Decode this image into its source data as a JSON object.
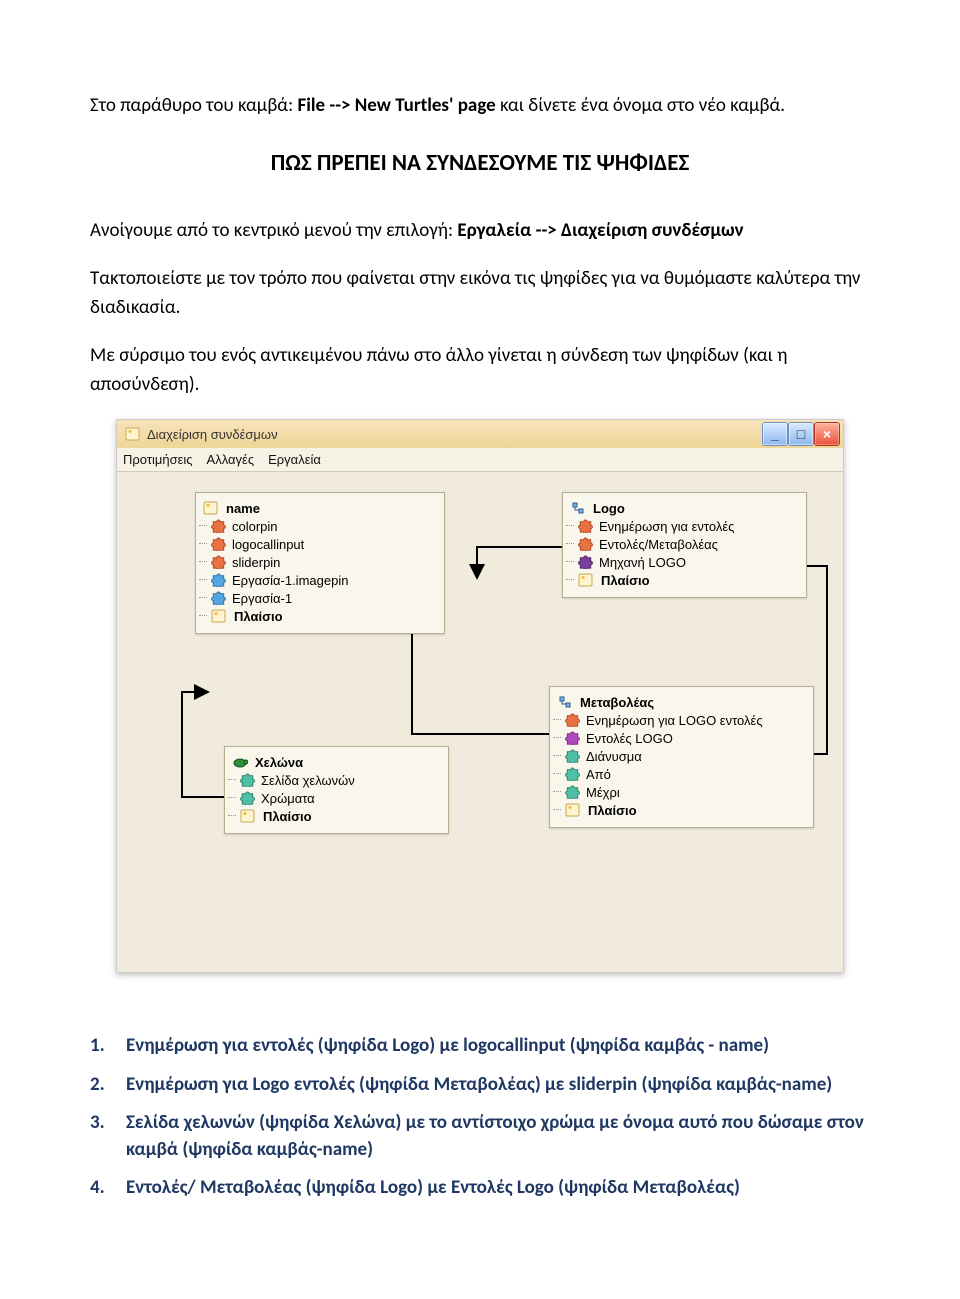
{
  "intro": {
    "prefix": "Στο παράθυρο του καμβά:",
    "bold1": "File --> New Turtles' page",
    "suffix": "και δίνετε ένα όνομα στο νέο καμβά."
  },
  "heading": "ΠΩΣ ΠΡΕΠΕΙ ΝΑ ΣΥΝΔΕΣΟΥΜΕ ΤΙΣ ΨΗΦΙΔΕΣ",
  "para1": {
    "prefix": "Ανοίγουμε από το κεντρικό μενού την επιλογή: ",
    "bold": "Εργαλεία --> Διαχείριση συνδέσμων"
  },
  "para2": "Τακτοποιείστε με τον τρόπο που φαίνεται στην εικόνα τις ψηφίδες για να θυμόμαστε καλύτερα την διαδικασία.",
  "para3": "Με σύρσιμο του ενός αντικειμένου πάνω στο άλλο γίνεται η σύνδεση των ψηφίδων  (και η αποσύνδεση).",
  "window": {
    "title": "Διαχείριση συνδέσμων",
    "menu": {
      "m1": "Προτιμήσεις",
      "m2": "Αλλαγές",
      "m3": "Εργαλεία"
    }
  },
  "panel_name": {
    "root": "name",
    "items": {
      "i0": "colorpin",
      "i1": "logocallinput",
      "i2": "sliderpin",
      "i3": "Εργασία-1.imagepin",
      "i4": "Εργασία-1",
      "plaisio": "Πλαίσιο"
    }
  },
  "panel_logo": {
    "root": "Logo",
    "items": {
      "i0": "Ενημέρωση για εντολές",
      "i1": "Εντολές/Μεταβολέας",
      "i2": "Μηχανή LOGO",
      "plaisio": "Πλαίσιο"
    }
  },
  "panel_turtle": {
    "root": "Χελώνα",
    "items": {
      "i0": "Σελίδα χελωνών",
      "i1": "Χρώματα",
      "plaisio": "Πλαίσιο"
    }
  },
  "panel_meta": {
    "root": "Μεταβολέας",
    "items": {
      "i0": "Ενημέρωση για LOGO εντολές",
      "i1": "Εντολές LOGO",
      "i2": "Διάνυσμα",
      "i3": "Από",
      "i4": "Μέχρι",
      "plaisio": "Πλαίσιο"
    }
  },
  "list": {
    "n1": "1.",
    "n2": "2.",
    "n3": "3.",
    "n4": "4.",
    "t1": "Ενημέρωση για εντολές (ψηφίδα Logo) με logocallinput (ψηφίδα καμβάς - name)",
    "t2": "Ενημέρωση για Logo εντολές (ψηφίδα Μεταβολέας) με sliderpin (ψηφίδα καμβάς-name)",
    "t3": "Σελίδα χελωνών (ψηφίδα Χελώνα) με το αντίστοιχο χρώμα με όνομα αυτό που δώσαμε στον καμβά (ψηφίδα καμβάς-name)",
    "t4": "Εντολές/ Μεταβολέας (ψηφίδα Logo) με Εντολές Logo (ψηφίδα Μεταβολέας)"
  }
}
